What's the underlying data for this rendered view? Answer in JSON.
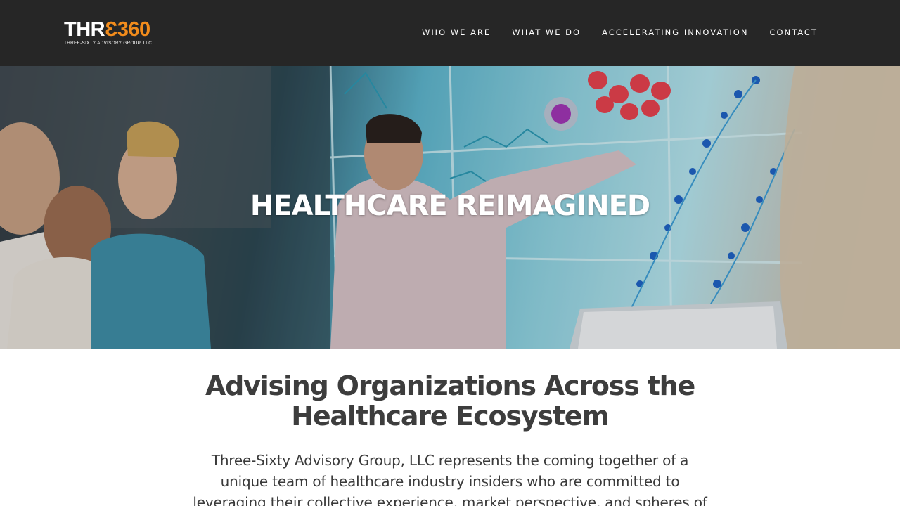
{
  "header": {
    "logo": {
      "part1": "THR",
      "part2": "Ɛ360",
      "tagline": "THREE-SIXTY ADVISORY GROUP, LLC"
    },
    "nav": [
      {
        "label": "WHO WE ARE"
      },
      {
        "label": "WHAT WE DO"
      },
      {
        "label": "ACCELERATING INNOVATION"
      },
      {
        "label": "CONTACT"
      }
    ]
  },
  "hero": {
    "title": "HEALTHCARE REIMAGINED"
  },
  "main": {
    "heading_line1": "Advising Organizations Across the",
    "heading_line2": "Healthcare Ecosystem",
    "paragraph": "Three-Sixty Advisory Group, LLC represents the coming together of a unique team of healthcare industry insiders who are committed to leveraging their collective experience, market perspective, and spheres of"
  },
  "colors": {
    "header_bg": "#262626",
    "accent_orange": "#f28c1c",
    "text_dark": "#3d3d3d"
  }
}
